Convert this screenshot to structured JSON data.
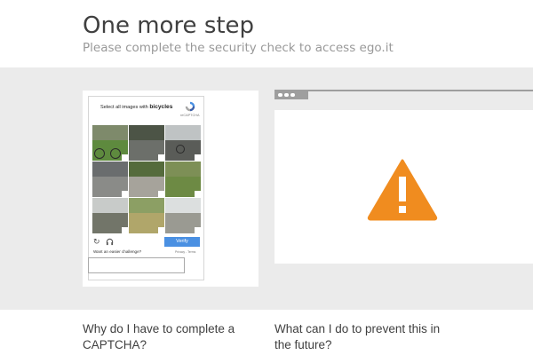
{
  "header": {
    "title": "One more step",
    "subtitle": "Please complete the security check to access ego.it"
  },
  "captcha": {
    "instruction_prefix": "Select all images with",
    "instruction_target": "bicycles",
    "brand": "reCAPTCHA",
    "verify_label": "Verify",
    "easier_label": "Want an easier challenge?",
    "privacy_label": "Privacy - Terms",
    "reload_icon": "reload-icon",
    "audio_icon": "headphones-icon",
    "input_value": ""
  },
  "browser": {
    "warning_icon": "warning-icon",
    "accent": "#f08c1f"
  },
  "faq": {
    "q1": "Why do I have to complete a CAPTCHA?",
    "q2": "What can I do to prevent this in the future?"
  }
}
